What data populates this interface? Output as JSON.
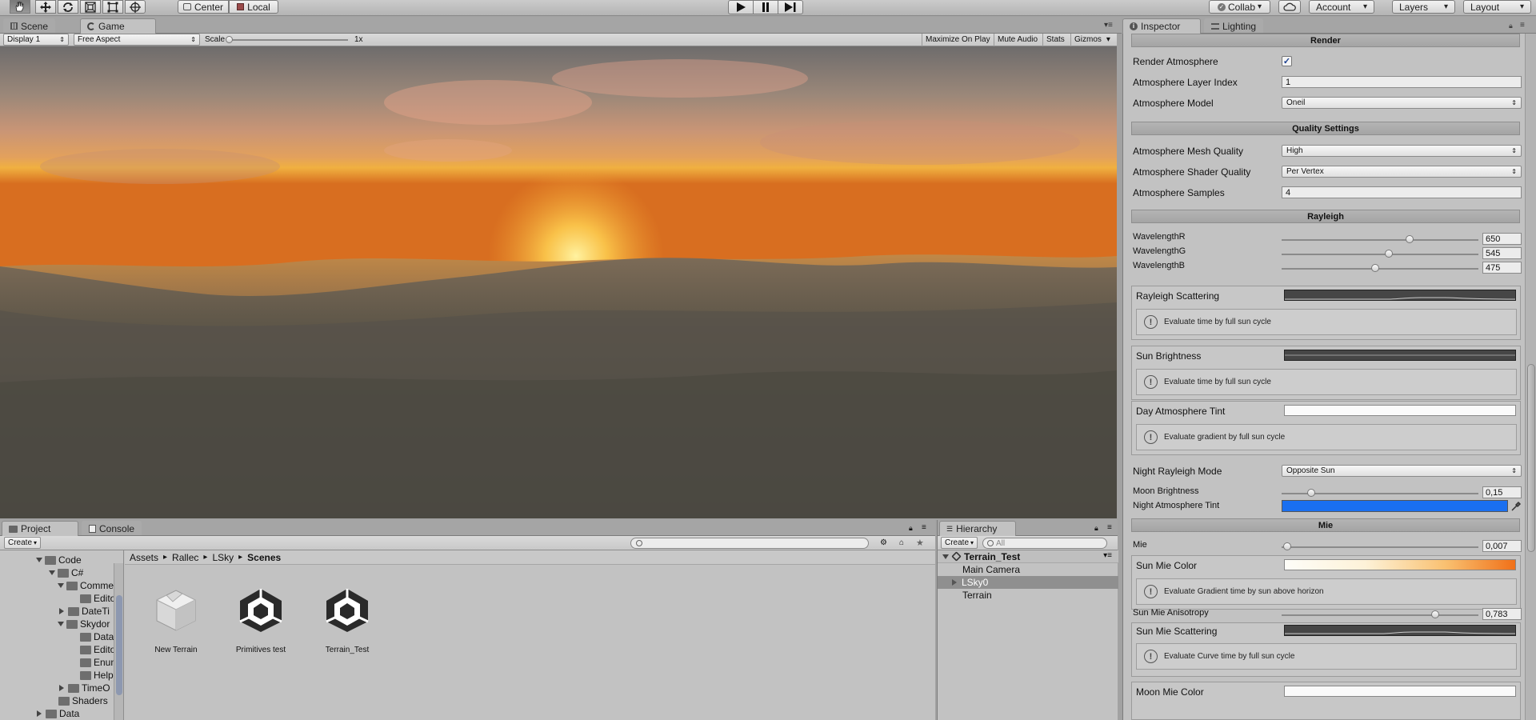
{
  "toolbar": {
    "tools": [
      "hand-icon",
      "move-icon",
      "rotate-icon",
      "scale-icon",
      "rect-icon",
      "transform-icon"
    ],
    "pivot_label": "Center",
    "space_label": "Local",
    "collab_label": "Collab",
    "account_label": "Account",
    "layers_label": "Layers",
    "layout_label": "Layout"
  },
  "game": {
    "tab_scene": "Scene",
    "tab_game": "Game",
    "display": "Display 1",
    "aspect": "Free Aspect",
    "scale_label": "Scale",
    "scale_value": "1x",
    "scale_fraction": 0.0,
    "maximize": "Maximize On Play",
    "mute": "Mute Audio",
    "stats": "Stats",
    "gizmos": "Gizmos"
  },
  "inspector": {
    "tab_inspector": "Inspector",
    "tab_lighting": "Lighting",
    "render_header": "Render",
    "render_atmosphere": "Render Atmosphere",
    "render_atmosphere_checked": true,
    "layer_index_label": "Atmosphere Layer Index",
    "layer_index_value": "1",
    "model_label": "Atmosphere Model",
    "model_value": "Oneil",
    "quality_header": "Quality Settings",
    "mesh_quality_label": "Atmosphere Mesh Quality",
    "mesh_quality_value": "High",
    "shader_quality_label": "Atmosphere Shader Quality",
    "shader_quality_value": "Per Vertex",
    "samples_label": "Atmosphere Samples",
    "samples_value": "4",
    "rayleigh_header": "Rayleigh",
    "wavelength_r_label": "WavelengthR",
    "wavelength_r_value": "650",
    "wavelength_r_fraction": 0.65,
    "wavelength_g_label": "WavelengthG",
    "wavelength_g_value": "545",
    "wavelength_g_fraction": 0.545,
    "wavelength_b_label": "WavelengthB",
    "wavelength_b_value": "475",
    "wavelength_b_fraction": 0.475,
    "rayleigh_scattering_label": "Rayleigh Scattering",
    "rayleigh_scattering_help": "Evaluate time by full sun cycle",
    "sun_brightness_label": "Sun Brightness",
    "sun_brightness_help": "Evaluate time by full sun cycle",
    "day_tint_label": "Day Atmosphere Tint",
    "day_tint_help": "Evaluate gradient by full sun cycle",
    "night_mode_label": "Night Rayleigh Mode",
    "night_mode_value": "Opposite Sun",
    "moon_brightness_label": "Moon Brightness",
    "moon_brightness_value": "0,15",
    "moon_brightness_fraction": 0.15,
    "night_tint_label": "Night Atmosphere Tint",
    "night_tint_color": "#1a6ff0",
    "mie_header": "Mie",
    "mie_label": "Mie",
    "mie_value": "0,007",
    "mie_fraction": 0.03,
    "sun_mie_color_label": "Sun Mie Color",
    "sun_mie_color_help": "Evaluate Gradient time by sun above horizon",
    "sun_mie_aniso_label": "Sun Mie Anisotropy",
    "sun_mie_aniso_value": "0,783",
    "sun_mie_aniso_fraction": 0.78,
    "sun_mie_scattering_label": "Sun Mie Scattering",
    "sun_mie_scattering_help": "Evaluate Curve time by full sun cycle",
    "moon_mie_color_label": "Moon Mie Color"
  },
  "project": {
    "tab_project": "Project",
    "tab_console": "Console",
    "create_label": "Create",
    "search_placeholder": "",
    "breadcrumb": [
      "Assets",
      "Rallec",
      "LSky",
      "Scenes"
    ],
    "tree": [
      "Code",
      "C#",
      "Comme",
      "Edito",
      "DateTi",
      "Skydor",
      "Data",
      "Edito",
      "Enun",
      "Help",
      "TimeO",
      "Shaders",
      "Data"
    ],
    "assets": [
      "New Terrain",
      "Primitives test",
      "Terrain_Test"
    ]
  },
  "hierarchy": {
    "tab_label": "Hierarchy",
    "create_label": "Create",
    "search_placeholder": "All",
    "scene_name": "Terrain_Test",
    "items": [
      "Main Camera",
      "LSky0",
      "Terrain"
    ]
  }
}
